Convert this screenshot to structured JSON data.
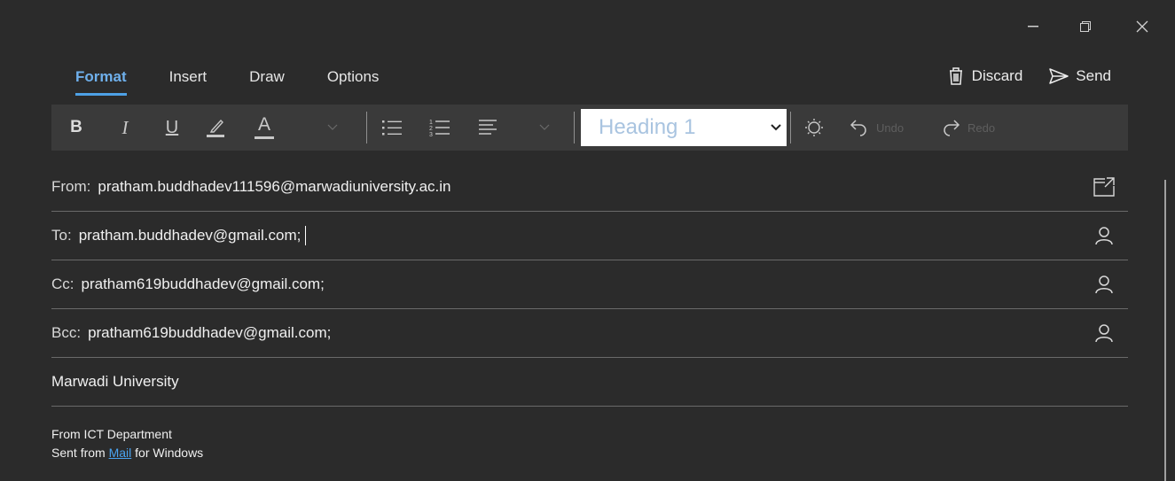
{
  "window": {
    "minimize_icon": "minimize-icon",
    "restore_icon": "restore-icon",
    "close_icon": "close-icon"
  },
  "tabs": [
    {
      "label": "Format",
      "active": true
    },
    {
      "label": "Insert",
      "active": false
    },
    {
      "label": "Draw",
      "active": false
    },
    {
      "label": "Options",
      "active": false
    }
  ],
  "actions": {
    "discard_label": "Discard",
    "send_label": "Send"
  },
  "toolbar": {
    "bold_label": "B",
    "italic_label": "I",
    "underline_label": "U",
    "font_color_label": "A",
    "style_value": "Heading 1",
    "undo_label": "Undo",
    "redo_label": "Redo"
  },
  "fields": {
    "from_label": "From:",
    "from_value": "pratham.buddhadev111596@marwadiuniversity.ac.in",
    "to_label": "To:",
    "to_value": "pratham.buddhadev@gmail.com;",
    "cc_label": "Cc:",
    "cc_value": "pratham619buddhadev@gmail.com;",
    "bcc_label": "Bcc:",
    "bcc_value": "pratham619buddhadev@gmail.com;",
    "subject_value": "Marwadi University"
  },
  "body": {
    "line1": "From ICT Department",
    "line2_prefix": "Sent from",
    "line2_link": "Mail",
    "line2_suffix": "for Windows"
  },
  "colors": {
    "accent": "#4ea1e6",
    "background": "#2b2b2b",
    "toolbar": "#3a3a3a",
    "link": "#4aa3f0"
  }
}
